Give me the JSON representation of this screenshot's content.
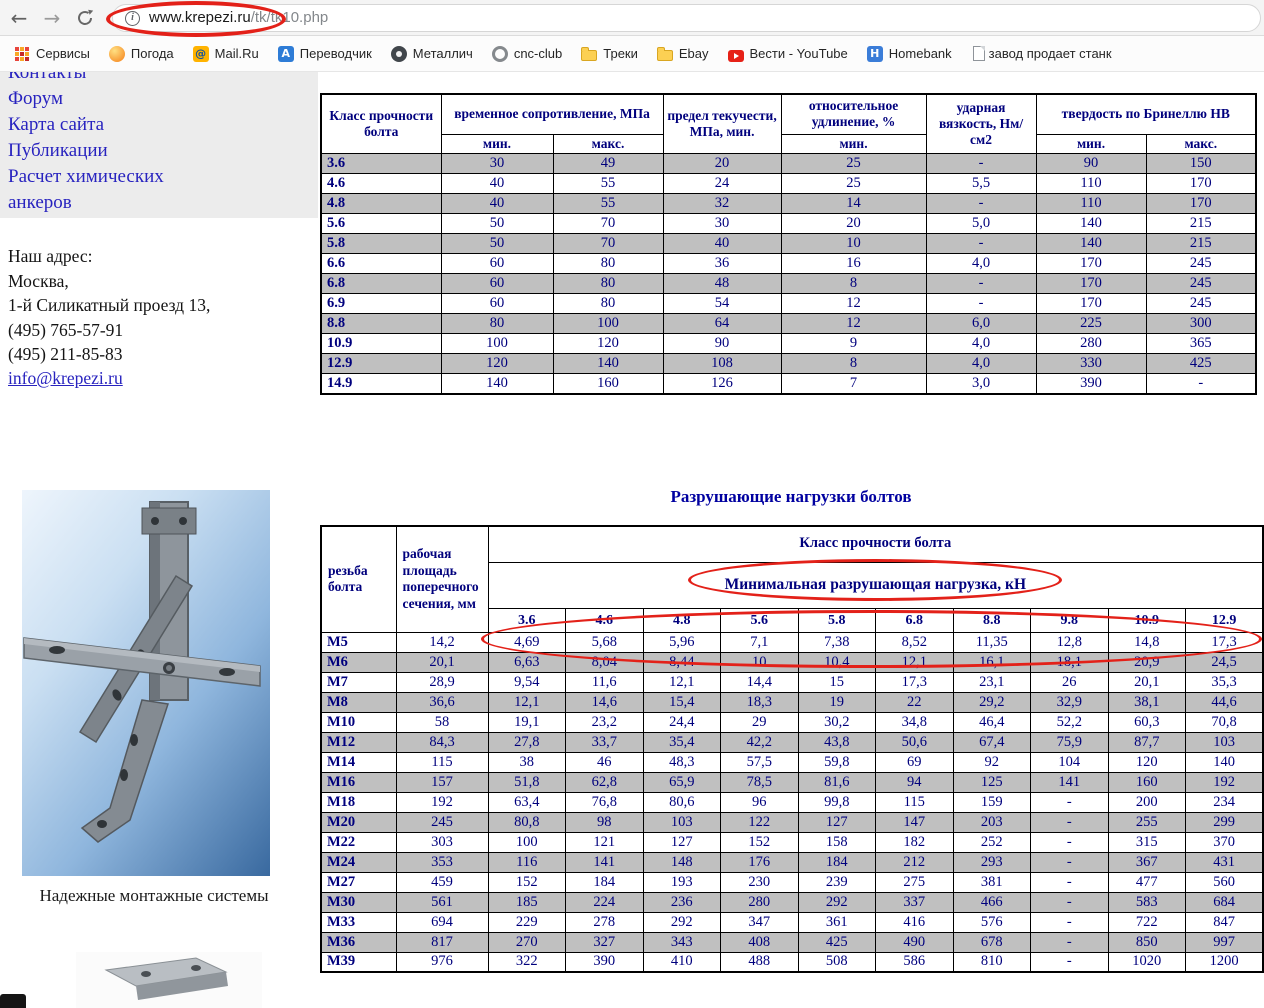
{
  "browser": {
    "url": {
      "host": "www.krepezi.ru",
      "path": "/tk/tk10.php"
    },
    "bookmarks": [
      {
        "label": "Сервисы",
        "icon": "apps-grid-icon"
      },
      {
        "label": "Погода",
        "icon": "weather-icon"
      },
      {
        "label": "Mail.Ru",
        "icon": "mail-icon"
      },
      {
        "label": "Переводчик",
        "icon": "translate-icon"
      },
      {
        "label": "Металлич",
        "icon": "gear-icon"
      },
      {
        "label": "cnc-club",
        "icon": "cnc-icon"
      },
      {
        "label": "Треки",
        "icon": "folder-icon"
      },
      {
        "label": "Ebay",
        "icon": "folder-icon"
      },
      {
        "label": "Вести - YouTube",
        "icon": "youtube-icon"
      },
      {
        "label": "Homebank",
        "icon": "homebank-icon"
      },
      {
        "label": "завод продает станк",
        "icon": "page-icon"
      }
    ]
  },
  "sidebar": {
    "links": [
      "Контакты",
      "Форум",
      "Карта сайта",
      "Публикации",
      "Расчет химических анкеров"
    ],
    "address_lines": [
      "Наш адрес:",
      "Москва,",
      "1-й Силикатный проезд 13,",
      "(495) 765-57-91",
      "(495) 211-85-83"
    ],
    "email": "info@krepezi.ru",
    "image_caption": "Надежные монтажные системы"
  },
  "strength_table": {
    "headers": {
      "class": "Класс прочности болта",
      "tensile": "временное сопротивление, МПа",
      "yield": "предел текучести, МПа, мин.",
      "elongation": "относительное удлинение, %",
      "impact": "ударная вязкость, Нм/см2",
      "hardness": "твердость по Бринеллю НВ",
      "min": "мин.",
      "max": "макс."
    },
    "rows": [
      [
        "3.6",
        "30",
        "49",
        "20",
        "25",
        "-",
        "90",
        "150"
      ],
      [
        "4.6",
        "40",
        "55",
        "24",
        "25",
        "5,5",
        "110",
        "170"
      ],
      [
        "4.8",
        "40",
        "55",
        "32",
        "14",
        "-",
        "110",
        "170"
      ],
      [
        "5.6",
        "50",
        "70",
        "30",
        "20",
        "5,0",
        "140",
        "215"
      ],
      [
        "5.8",
        "50",
        "70",
        "40",
        "10",
        "-",
        "140",
        "215"
      ],
      [
        "6.6",
        "60",
        "80",
        "36",
        "16",
        "4,0",
        "170",
        "245"
      ],
      [
        "6.8",
        "60",
        "80",
        "48",
        "8",
        "-",
        "170",
        "245"
      ],
      [
        "6.9",
        "60",
        "80",
        "54",
        "12",
        "-",
        "170",
        "245"
      ],
      [
        "8.8",
        "80",
        "100",
        "64",
        "12",
        "6,0",
        "225",
        "300"
      ],
      [
        "10.9",
        "100",
        "120",
        "90",
        "9",
        "4,0",
        "280",
        "365"
      ],
      [
        "12.9",
        "120",
        "140",
        "108",
        "8",
        "4,0",
        "330",
        "425"
      ],
      [
        "14.9",
        "140",
        "160",
        "126",
        "7",
        "3,0",
        "390",
        "-"
      ]
    ]
  },
  "load_table": {
    "title": "Разрушающие нагрузки болтов",
    "headers": {
      "thread": "резьба болта",
      "area": "рабочая площадь поперечного сечения, мм",
      "class_group": "Класс прочности болта",
      "load_label": "Минимальная разрушающая нагрузка, кН",
      "classes": [
        "3.6",
        "4.6",
        "4.8",
        "5.6",
        "5.8",
        "6.8",
        "8.8",
        "9.8",
        "10.9",
        "12.9"
      ]
    },
    "rows": [
      [
        "М5",
        "14,2",
        "4,69",
        "5,68",
        "5,96",
        "7,1",
        "7,38",
        "8,52",
        "11,35",
        "12,8",
        "14,8",
        "17,3"
      ],
      [
        "М6",
        "20,1",
        "6,63",
        "8,04",
        "8,44",
        "10",
        "10,4",
        "12,1",
        "16,1",
        "18,1",
        "20,9",
        "24,5"
      ],
      [
        "М7",
        "28,9",
        "9,54",
        "11,6",
        "12,1",
        "14,4",
        "15",
        "17,3",
        "23,1",
        "26",
        "20,1",
        "35,3"
      ],
      [
        "М8",
        "36,6",
        "12,1",
        "14,6",
        "15,4",
        "18,3",
        "19",
        "22",
        "29,2",
        "32,9",
        "38,1",
        "44,6"
      ],
      [
        "М10",
        "58",
        "19,1",
        "23,2",
        "24,4",
        "29",
        "30,2",
        "34,8",
        "46,4",
        "52,2",
        "60,3",
        "70,8"
      ],
      [
        "М12",
        "84,3",
        "27,8",
        "33,7",
        "35,4",
        "42,2",
        "43,8",
        "50,6",
        "67,4",
        "75,9",
        "87,7",
        "103"
      ],
      [
        "М14",
        "115",
        "38",
        "46",
        "48,3",
        "57,5",
        "59,8",
        "69",
        "92",
        "104",
        "120",
        "140"
      ],
      [
        "М16",
        "157",
        "51,8",
        "62,8",
        "65,9",
        "78,5",
        "81,6",
        "94",
        "125",
        "141",
        "160",
        "192"
      ],
      [
        "М18",
        "192",
        "63,4",
        "76,8",
        "80,6",
        "96",
        "99,8",
        "115",
        "159",
        "-",
        "200",
        "234"
      ],
      [
        "М20",
        "245",
        "80,8",
        "98",
        "103",
        "122",
        "127",
        "147",
        "203",
        "-",
        "255",
        "299"
      ],
      [
        "М22",
        "303",
        "100",
        "121",
        "127",
        "152",
        "158",
        "182",
        "252",
        "-",
        "315",
        "370"
      ],
      [
        "М24",
        "353",
        "116",
        "141",
        "148",
        "176",
        "184",
        "212",
        "293",
        "-",
        "367",
        "431"
      ],
      [
        "М27",
        "459",
        "152",
        "184",
        "193",
        "230",
        "239",
        "275",
        "381",
        "-",
        "477",
        "560"
      ],
      [
        "М30",
        "561",
        "185",
        "224",
        "236",
        "280",
        "292",
        "337",
        "466",
        "-",
        "583",
        "684"
      ],
      [
        "М33",
        "694",
        "229",
        "278",
        "292",
        "347",
        "361",
        "416",
        "576",
        "-",
        "722",
        "847"
      ],
      [
        "М36",
        "817",
        "270",
        "327",
        "343",
        "408",
        "425",
        "490",
        "678",
        "-",
        "850",
        "997"
      ],
      [
        "М39",
        "976",
        "322",
        "390",
        "410",
        "488",
        "508",
        "586",
        "810",
        "-",
        "1020",
        "1200"
      ]
    ]
  },
  "colors": {
    "annotation_red": "#e32119",
    "row_gray": "#c0c0c0",
    "header_navy": "#00007d",
    "link_blue": "#2823bf"
  }
}
